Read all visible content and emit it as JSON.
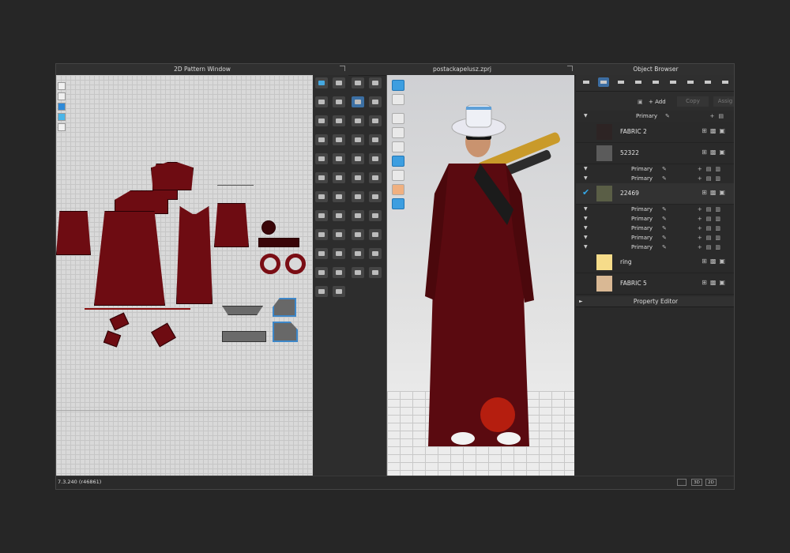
{
  "windows": {
    "pattern_title": "2D Pattern Window",
    "viewport_title": "postackapelusz.zprj",
    "browser_title": "Object Browser"
  },
  "object_browser": {
    "add_label": "+ Add",
    "copy_label": "Copy",
    "assign_label": "Assig",
    "group_label": "Primary",
    "fabrics": [
      {
        "name": "FABRIC 2",
        "color": "#2d2424"
      },
      {
        "name": "52322",
        "color": "#5b5b5b"
      },
      {
        "name": "22469",
        "color": "#5a5e46",
        "checked": true
      },
      {
        "name": "ring",
        "color": "#f6dc8a"
      },
      {
        "name": "FABRIC 5",
        "color": "#d9b894"
      }
    ],
    "primary_rows_a": [
      "Primary",
      "Primary"
    ],
    "primary_rows_b": [
      "Primary",
      "Primary",
      "Primary",
      "Primary",
      "Primary"
    ]
  },
  "property_editor": {
    "title": "Property Editor"
  },
  "status": {
    "version": "7.3.240 (r46861)",
    "view_buttons": [
      "",
      "3D",
      "2D"
    ]
  },
  "icons": [
    "popout-icon",
    "list-icon",
    "fabric-icon",
    "grid-icon",
    "globe-icon",
    "pencil-icon",
    "plus-icon",
    "folder-icon",
    "trash-icon",
    "check-icon"
  ]
}
